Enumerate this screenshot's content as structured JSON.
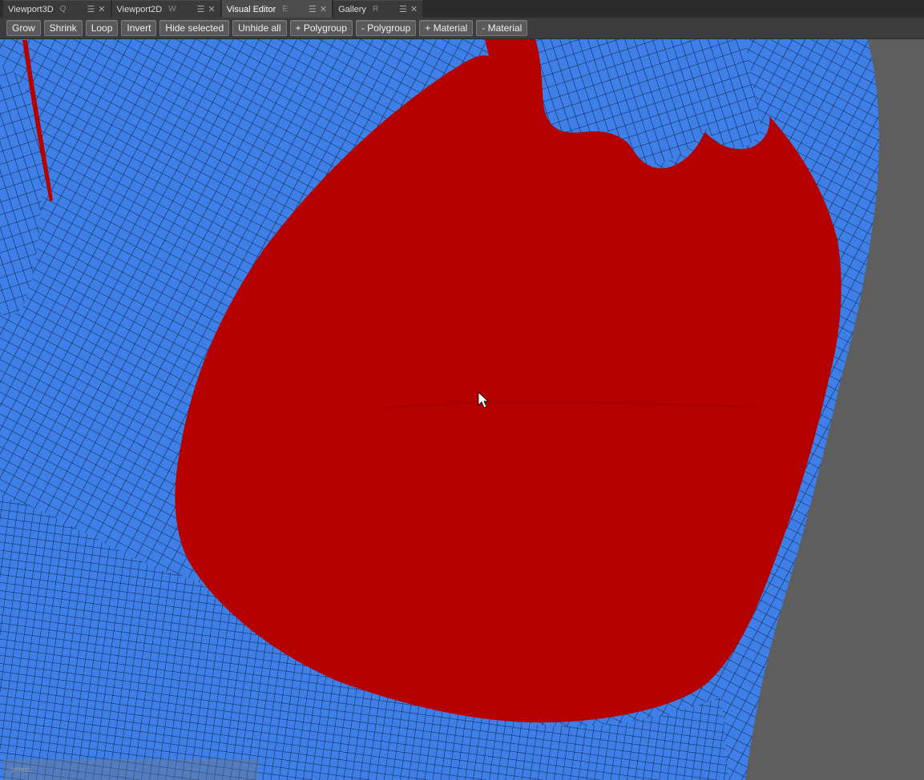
{
  "tabs": [
    {
      "label": "Viewport3D",
      "key": "Q",
      "active": false
    },
    {
      "label": "Viewport2D",
      "key": "W",
      "active": false
    },
    {
      "label": "Visual Editor",
      "key": "E",
      "active": true
    },
    {
      "label": "Gallery",
      "key": "R",
      "active": false
    }
  ],
  "tab_icons": {
    "menu": "☰",
    "close": "✕"
  },
  "toolbar": {
    "grow": "Grow",
    "shrink": "Shrink",
    "loop": "Loop",
    "invert": "Invert",
    "hide_selected": "Hide selected",
    "unhide_all": "Unhide all",
    "add_polygroup": "+ Polygroup",
    "remove_polygroup": "- Polygroup",
    "add_material": "+ Material",
    "remove_material": "- Material"
  },
  "viewport": {
    "mesh_color": "#3f7fe8",
    "wire_color": "#0e2344",
    "selection_color": "#b50000",
    "background_color": "#5e5e5e"
  },
  "status": {
    "text": "select"
  }
}
